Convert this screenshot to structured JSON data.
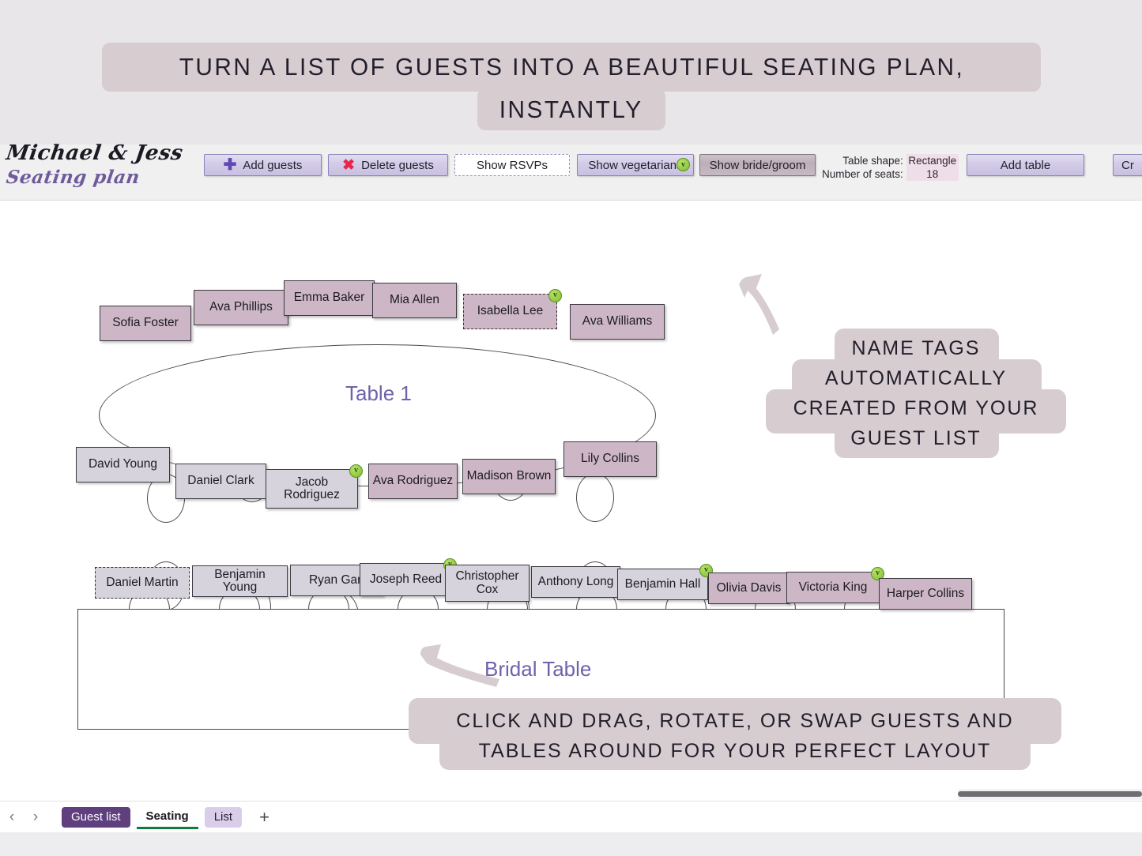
{
  "promo": {
    "line1": "TURN A LIST OF GUESTS INTO A BEAUTIFUL SEATING PLAN,",
    "line2": "INSTANTLY"
  },
  "brand": {
    "line1": "Michael & Jess",
    "line2": "Seating plan"
  },
  "toolbar": {
    "add_guests": "Add guests",
    "delete_guests": "Delete guests",
    "show_rsvps": "Show RSVPs",
    "show_vegetarians": "Show vegetarians",
    "show_bride_groom": "Show bride/groom",
    "add_table": "Add table",
    "create_truncated": "Cr",
    "veg_badge": "v",
    "plus_icon": "plus-icon",
    "x_icon": "x-icon",
    "table_shape_label": "Table shape:",
    "table_shape_value": "Rectangle",
    "number_of_seats_label": "Number of seats:",
    "number_of_seats_value": "18"
  },
  "tables": [
    {
      "id": "table-1",
      "label": "Table 1",
      "shape": "ellipse"
    },
    {
      "id": "bridal-table",
      "label": "Bridal Table",
      "shape": "rectangle"
    }
  ],
  "table1_guests_top": [
    {
      "name": "Sofia Foster",
      "color": "mauve",
      "vegetarian": false,
      "selected": false
    },
    {
      "name": "Ava Phillips",
      "color": "mauve",
      "vegetarian": false,
      "selected": false
    },
    {
      "name": "Emma Baker",
      "color": "mauve",
      "vegetarian": false,
      "selected": false
    },
    {
      "name": "Mia Allen",
      "color": "mauve",
      "vegetarian": false,
      "selected": false
    },
    {
      "name": "Isabella Lee",
      "color": "mauve",
      "vegetarian": true,
      "selected": true
    },
    {
      "name": "Ava Williams",
      "color": "mauve",
      "vegetarian": false,
      "selected": false
    }
  ],
  "table1_guests_bottom": [
    {
      "name": "David Young",
      "color": "gray",
      "vegetarian": false,
      "selected": false
    },
    {
      "name": "Daniel Clark",
      "color": "gray",
      "vegetarian": false,
      "selected": false
    },
    {
      "name": "Jacob Rodriguez",
      "color": "gray",
      "vegetarian": true,
      "selected": false
    },
    {
      "name": "Ava Rodriguez",
      "color": "mauve",
      "vegetarian": false,
      "selected": false
    },
    {
      "name": "Madison Brown",
      "color": "mauve",
      "vegetarian": false,
      "selected": false
    },
    {
      "name": "Lily Collins",
      "color": "mauve",
      "vegetarian": false,
      "selected": false
    }
  ],
  "bridal_guests": [
    {
      "name": "Daniel Martin",
      "color": "gray",
      "vegetarian": false,
      "selected": true
    },
    {
      "name": "Benjamin Young",
      "color": "gray",
      "vegetarian": false,
      "selected": false
    },
    {
      "name": "Ryan Garc",
      "color": "gray",
      "vegetarian": false,
      "selected": false
    },
    {
      "name": "Joseph Reed",
      "color": "gray",
      "vegetarian": true,
      "selected": false
    },
    {
      "name": "Christopher Cox",
      "color": "gray",
      "vegetarian": false,
      "selected": false
    },
    {
      "name": "Anthony Long",
      "color": "gray",
      "vegetarian": false,
      "selected": false
    },
    {
      "name": "Benjamin Hall",
      "color": "gray",
      "vegetarian": true,
      "selected": false
    },
    {
      "name": "Olivia Davis",
      "color": "mauve",
      "vegetarian": false,
      "selected": false
    },
    {
      "name": "Victoria King",
      "color": "mauve",
      "vegetarian": true,
      "selected": false
    },
    {
      "name": "Harper Collins",
      "color": "mauve",
      "vegetarian": false,
      "selected": false
    }
  ],
  "callouts": {
    "right": "NAME TAGS AUTOMATICALLY CREATED FROM YOUR GUEST LIST",
    "right_lines": [
      "NAME TAGS",
      "AUTOMATICALLY",
      "CREATED FROM YOUR",
      "GUEST LIST"
    ],
    "bottom": "CLICK AND DRAG, ROTATE, OR SWAP GUESTS AND TABLES AROUND FOR YOUR PERFECT LAYOUT",
    "bottom_lines": [
      "CLICK AND DRAG, ROTATE, OR SWAP GUESTS AND",
      "TABLES AROUND FOR YOUR PERFECT LAYOUT"
    ]
  },
  "sheetbar": {
    "prev_icon": "‹",
    "next_icon": "›",
    "tabs": [
      {
        "label": "Guest list",
        "style": "solid"
      },
      {
        "label": "Seating",
        "style": "active"
      },
      {
        "label": "List",
        "style": "light"
      }
    ],
    "add_label": "+"
  },
  "colors": {
    "promo_bg": "#d7cdd1",
    "brand_accent": "#6f5a9c",
    "table_label": "#6e62ab",
    "tag_mauve": "#cdb7c6",
    "tag_gray": "#d6d3dd",
    "veg_green": "#7fc030",
    "delete_red": "#e8264b",
    "add_purple": "#5f49b5",
    "active_tab_underline": "#0f7b3c",
    "guest_list_tab": "#5f3f7e"
  }
}
